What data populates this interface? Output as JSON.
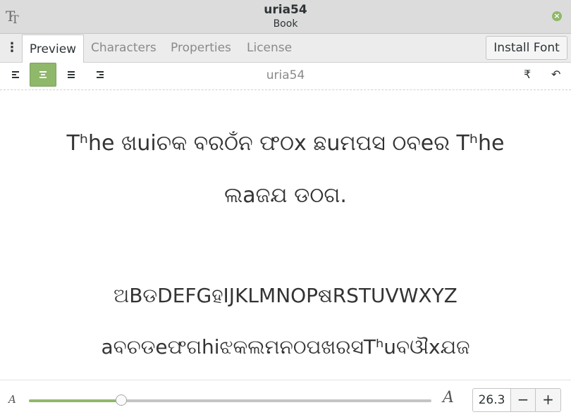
{
  "window": {
    "title": "uria54",
    "subtitle": "Book",
    "app_icon": "font-viewer-icon",
    "close_icon": "close-icon",
    "close_glyph": "×"
  },
  "tabs": {
    "menu_glyph": "⋮",
    "items": [
      {
        "label": "Preview",
        "active": true
      },
      {
        "label": "Characters",
        "active": false
      },
      {
        "label": "Properties",
        "active": false
      },
      {
        "label": "License",
        "active": false
      }
    ],
    "install_label": "Install Font"
  },
  "toolbar": {
    "title": "uria54",
    "align_options": [
      "align-left",
      "align-center",
      "align-justify",
      "align-right"
    ],
    "active_align": "align-center",
    "right_icons": [
      "text-direction-icon",
      "undo-icon"
    ],
    "direction_glyph": "₹",
    "undo_glyph": "↶"
  },
  "preview": {
    "line1": "Tʰhe ଖuiଚକ ବରଠଁନ ଫଠx ଛuମପସ ଠବeର Tʰhe",
    "line2": "ଲaଜଯ ଡଠଗ.",
    "uppercase": "ଅBଡDEFGହIJKLMNOPଷRSTUVWXYZ",
    "lowercase": "aବଚଡeଫଗhiଝକଲମନଠପଖରସTʰuବଔxଯଜ"
  },
  "size": {
    "min_glyph": "A",
    "max_glyph": "A",
    "value": "26.3",
    "fraction": 0.23,
    "minus": "−",
    "plus": "+"
  },
  "colors": {
    "accent": "#8fb86b",
    "header_bg": "#dcdcdc",
    "text": "#2e3436"
  }
}
